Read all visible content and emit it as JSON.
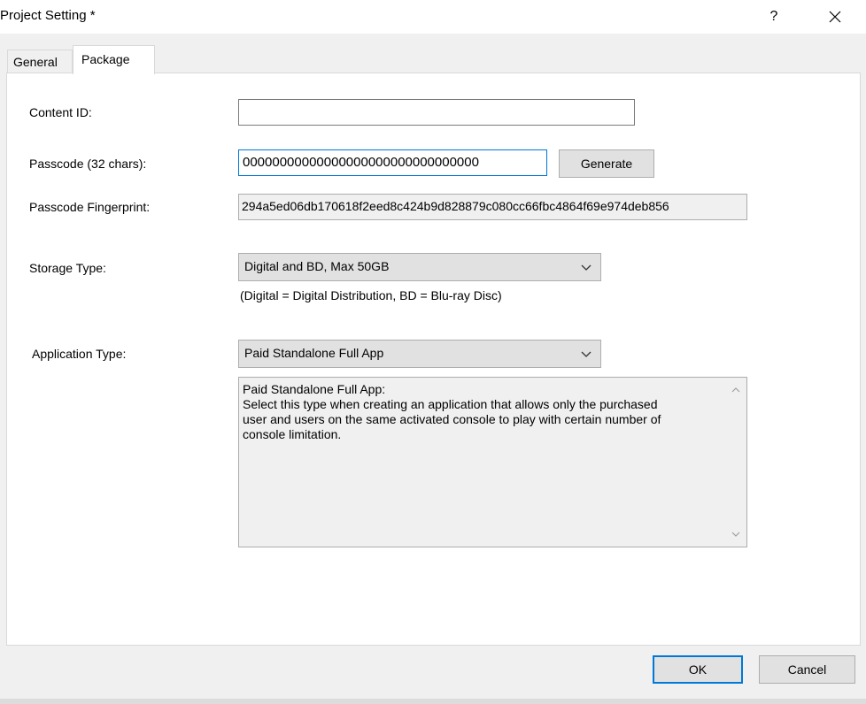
{
  "window": {
    "title": "Project Setting *",
    "help_label": "?",
    "close_icon": "close-icon"
  },
  "tabs": [
    {
      "label": "General",
      "selected": false
    },
    {
      "label": "Package",
      "selected": true
    }
  ],
  "form": {
    "content_id": {
      "label": "Content ID:",
      "value": ""
    },
    "passcode": {
      "label": "Passcode (32 chars):",
      "value": "00000000000000000000000000000000",
      "generate_label": "Generate"
    },
    "fingerprint": {
      "label": "Passcode Fingerprint:",
      "value": "294a5ed06db170618f2eed8c424b9d828879c080cc66fbc4864f69e974deb856"
    },
    "storage_type": {
      "label": "Storage Type:",
      "selected": "Digital and BD, Max 50GB",
      "note": "(Digital = Digital Distribution, BD = Blu-ray Disc)"
    },
    "application_type": {
      "label": "Application Type:",
      "selected": "Paid Standalone Full App",
      "description_lines": [
        "Paid Standalone Full App:",
        "Select this type when creating an application that allows only the purchased",
        "user and users on the same activated console to play with certain number of",
        "console limitation."
      ]
    }
  },
  "buttons": {
    "ok": "OK",
    "cancel": "Cancel"
  },
  "colors": {
    "focus_border": "#0078d7",
    "button_face": "#e1e1e1",
    "dialog_bg": "#f0f0f0"
  }
}
